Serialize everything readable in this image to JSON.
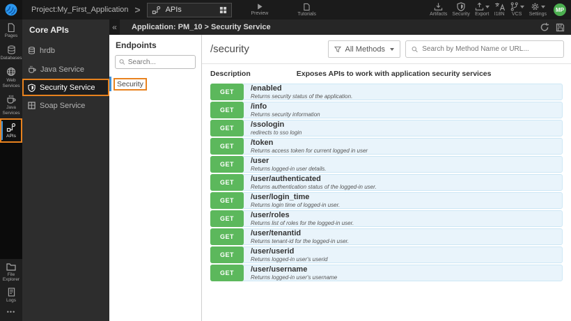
{
  "topbar": {
    "project_label": "Project:My_First_Application",
    "breadcrumb_chevron": ">",
    "apis_dropdown_label": "APIs",
    "preview_label": "Preview",
    "tutorials_label": "Tutorials",
    "right_items": [
      {
        "label": "Artifacts",
        "icon": "artifacts-icon"
      },
      {
        "label": "Security",
        "icon": "security-icon"
      },
      {
        "label": "Export",
        "icon": "export-icon"
      },
      {
        "label": "I18N",
        "icon": "i18n-icon"
      },
      {
        "label": "VCS",
        "icon": "vcs-icon"
      },
      {
        "label": "Settings",
        "icon": "settings-icon"
      }
    ],
    "avatar_initials": "MP"
  },
  "sidebar": {
    "top_items": [
      {
        "label": "Pages",
        "icon": "pages-icon",
        "active": false
      },
      {
        "label": "Databases",
        "icon": "databases-icon",
        "active": false
      },
      {
        "label": "Web Services",
        "icon": "web-services-icon",
        "active": false
      },
      {
        "label": "Java Services",
        "icon": "java-services-icon",
        "active": false
      },
      {
        "label": "APIs",
        "icon": "apis-icon",
        "active": true
      }
    ],
    "bottom_items": [
      {
        "label": "File Explorer",
        "icon": "file-explorer-icon"
      },
      {
        "label": "Logs",
        "icon": "logs-icon"
      }
    ],
    "more_dots": "•••"
  },
  "core_apis_panel": {
    "title": "Core APIs",
    "items": [
      {
        "label": "hrdb",
        "icon": "database-icon",
        "active": false
      },
      {
        "label": "Java Service",
        "icon": "coffee-icon",
        "active": false
      },
      {
        "label": "Security Service",
        "icon": "shield-icon",
        "active": true
      },
      {
        "label": "Soap Service",
        "icon": "soap-icon",
        "active": false
      }
    ]
  },
  "content_header": {
    "collapse_glyph": "«",
    "breadcrumb": "Application: PM_10 > Security Service"
  },
  "endpoints_panel": {
    "title": "Endpoints",
    "search_placeholder": "Search...",
    "items": [
      {
        "label": "Security",
        "active": true
      }
    ]
  },
  "main": {
    "title": "/security",
    "methods_filter_label": "All Methods",
    "search_placeholder": "Search by Method Name or URL...",
    "description_label": "Description",
    "description_value": "Exposes APIs to work with application security services",
    "endpoints": [
      {
        "method": "GET",
        "path": "/enabled",
        "description": "Returns security status of the application."
      },
      {
        "method": "GET",
        "path": "/info",
        "description": "Returns security information"
      },
      {
        "method": "GET",
        "path": "/ssologin",
        "description": "redirects to sso login"
      },
      {
        "method": "GET",
        "path": "/token",
        "description": "Returns access token for current logged in user"
      },
      {
        "method": "GET",
        "path": "/user",
        "description": "Returns logged-in user details."
      },
      {
        "method": "GET",
        "path": "/user/authenticated",
        "description": "Returns authentication status of the logged-in user."
      },
      {
        "method": "GET",
        "path": "/user/login_time",
        "description": "Returns login time of logged-in user."
      },
      {
        "method": "GET",
        "path": "/user/roles",
        "description": "Returns list of roles for the logged-in user."
      },
      {
        "method": "GET",
        "path": "/user/tenantid",
        "description": "Returns tenant-id for the logged-in user."
      },
      {
        "method": "GET",
        "path": "/user/userid",
        "description": "Returns logged-in user's userid"
      },
      {
        "method": "GET",
        "path": "/user/username",
        "description": "Returns logged-in user's username"
      }
    ]
  },
  "colors": {
    "accent_orange": "#e8821e",
    "get_green": "#5cb85c",
    "row_bg": "#e9f4fb",
    "row_border": "#cde7f5",
    "selected_blue": "#3f8fd4",
    "avatar_green": "#4caf50",
    "topbar_bg": "#1b1b1b",
    "panel_dark": "#2d2d2d"
  }
}
